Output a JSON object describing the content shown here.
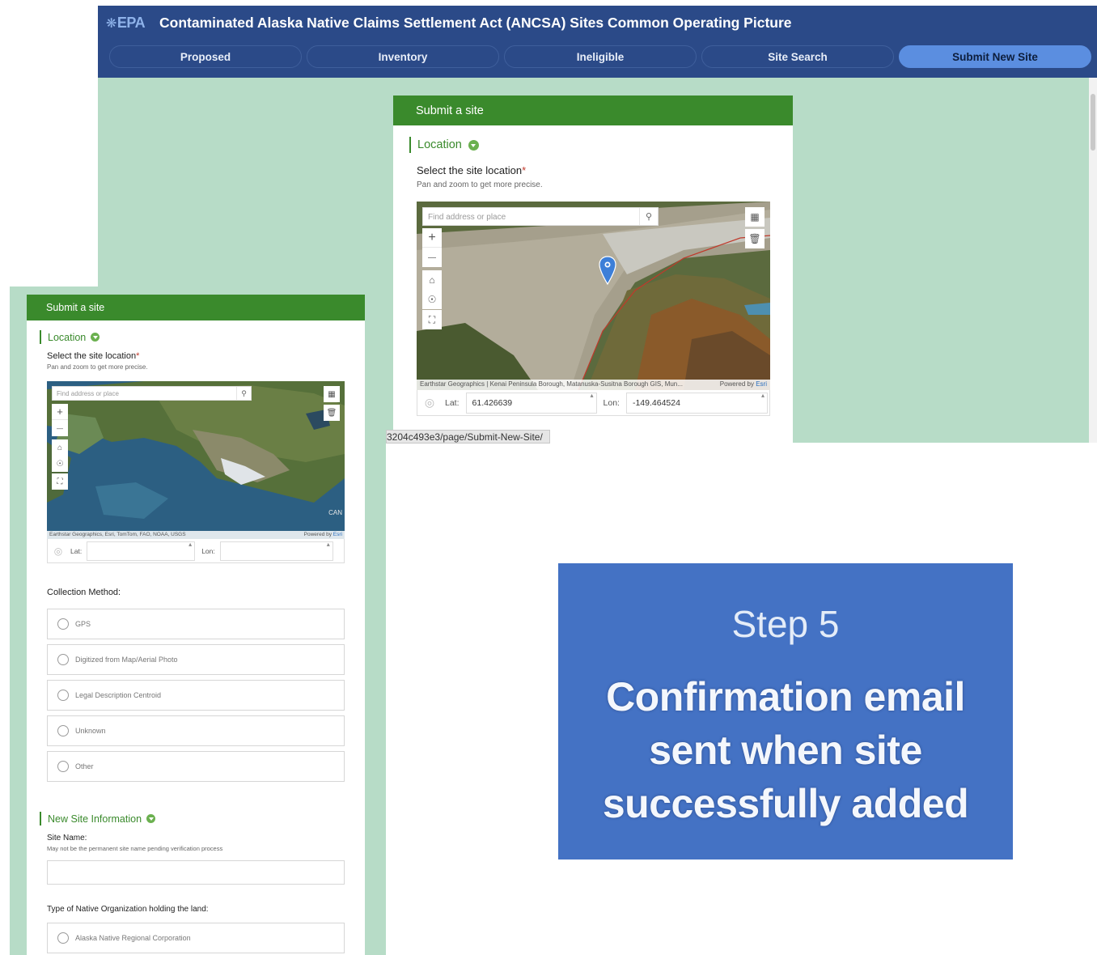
{
  "app": {
    "logo": "EPA",
    "title": "Contaminated  Alaska Native Claims Settlement Act (ANCSA) Sites Common Operating Picture",
    "nav": [
      {
        "label": "Proposed",
        "active": false
      },
      {
        "label": "Inventory",
        "active": false
      },
      {
        "label": "Ineligible",
        "active": false
      },
      {
        "label": "Site Search",
        "active": false
      },
      {
        "label": "Submit New Site",
        "active": true
      }
    ],
    "colors": {
      "header": "#2b4a88",
      "active_tab": "#5b8ee0",
      "background": "#b7dcc7",
      "form_header": "#3a8a2c"
    }
  },
  "right_form": {
    "header": "Submit a site",
    "section": "Location",
    "question": "Select the site location",
    "required_mark": "*",
    "hint": "Pan and zoom to get more precise.",
    "map": {
      "search_placeholder": "Find address or place",
      "zoom_in": "+",
      "zoom_out": "—",
      "attribution": "Earthstar Geographics | Kenai Peninsula Borough, Matanuska-Susitna Borough GIS, Mun...",
      "powered_by": "Powered by",
      "esri": "Esri",
      "marker_icon": "map-pin-icon"
    },
    "lat_label": "Lat:",
    "lat_value": "61.426639",
    "lon_label": "Lon:",
    "lon_value": "-149.464524"
  },
  "url_tooltip": "3204c493e3/page/Submit-New-Site/",
  "left_form": {
    "header": "Submit a site",
    "section": "Location",
    "question": "Select the site location",
    "required_mark": "*",
    "hint": "Pan and zoom to get more precise.",
    "map": {
      "search_placeholder": "Find address or place",
      "zoom_in": "+",
      "zoom_out": "—",
      "attribution": "Earthstar Geographics, Esri, TomTom, FAO, NOAA, USGS",
      "powered_by": "Powered by",
      "esri": "Esri",
      "region_label": "CAN"
    },
    "lat_label": "Lat:",
    "lon_label": "Lon:",
    "collection_label": "Collection Method:",
    "collection_options": [
      "GPS",
      "Digitized from Map/Aerial Photo",
      "Legal Description Centroid",
      "Unknown",
      "Other"
    ],
    "new_site_section": "New Site Information",
    "site_name_label": "Site Name:",
    "site_name_hint": "May not be the permanent site name pending verification process",
    "org_type_label": "Type of Native Organization holding the land:",
    "org_option_1": "Alaska Native Regional Corporation"
  },
  "callout": {
    "title": "Step 5",
    "body_line1": "Confirmation email",
    "body_line2": "sent when site",
    "body_line3": "successfully added",
    "color": "#4472c4"
  }
}
